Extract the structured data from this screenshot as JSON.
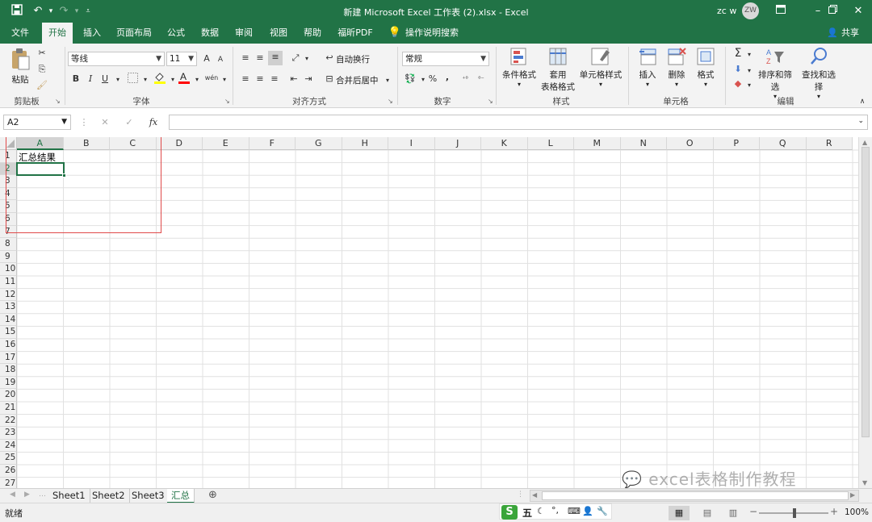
{
  "window": {
    "title": "新建 Microsoft Excel 工作表 (2).xlsx  -  Excel",
    "user_name": "zc w",
    "user_initials": "ZW"
  },
  "tabs": [
    "文件",
    "开始",
    "插入",
    "页面布局",
    "公式",
    "数据",
    "审阅",
    "视图",
    "帮助",
    "福昕PDF"
  ],
  "active_tab": "开始",
  "tell_me": "操作说明搜索",
  "share": "共享",
  "ribbon": {
    "clipboard": {
      "paste": "粘贴",
      "label": "剪贴板"
    },
    "font": {
      "name": "等线",
      "size": "11",
      "bold": "B",
      "italic": "I",
      "underline": "U",
      "label": "字体",
      "grow": "A",
      "shrink": "A",
      "font_color": "A",
      "highlight_color": "#ffff00",
      "font_color_value": "#ff0000",
      "phonetic": "wén"
    },
    "alignment": {
      "wrap": "自动换行",
      "merge": "合并后居中",
      "label": "对齐方式"
    },
    "number": {
      "format": "常规",
      "percent": "%",
      "comma": ",",
      "label": "数字"
    },
    "styles": {
      "conditional": "条件格式",
      "table_1": "套用",
      "table_2": "表格格式",
      "cell_styles": "单元格样式",
      "label": "样式"
    },
    "cells": {
      "insert": "插入",
      "delete": "删除",
      "format": "格式",
      "label": "单元格"
    },
    "editing": {
      "sort": "排序和筛选",
      "find": "查找和选择",
      "label": "编辑"
    }
  },
  "formula_bar": {
    "name_box": "A2",
    "fx": "fx",
    "formula": ""
  },
  "columns": [
    "A",
    "B",
    "C",
    "D",
    "E",
    "F",
    "G",
    "H",
    "I",
    "J",
    "K",
    "L",
    "M",
    "N",
    "O",
    "P",
    "Q",
    "R"
  ],
  "rows": [
    "1",
    "2",
    "3",
    "4",
    "5",
    "6",
    "7",
    "8",
    "9",
    "10",
    "11",
    "12",
    "13",
    "14",
    "15",
    "16",
    "17",
    "18",
    "19",
    "20",
    "21",
    "22",
    "23",
    "24",
    "25",
    "26",
    "27"
  ],
  "cells": {
    "A1": "汇总结果"
  },
  "selected_cell": "A2",
  "sheets": [
    "Sheet1",
    "Sheet2",
    "Sheet3",
    "汇总"
  ],
  "active_sheet": "汇总",
  "watermark": "excel表格制作教程",
  "status": {
    "mode": "就绪",
    "zoom": "100%",
    "ime": "五"
  },
  "colors": {
    "accent": "#217346",
    "annotation": "#e04a4a"
  }
}
